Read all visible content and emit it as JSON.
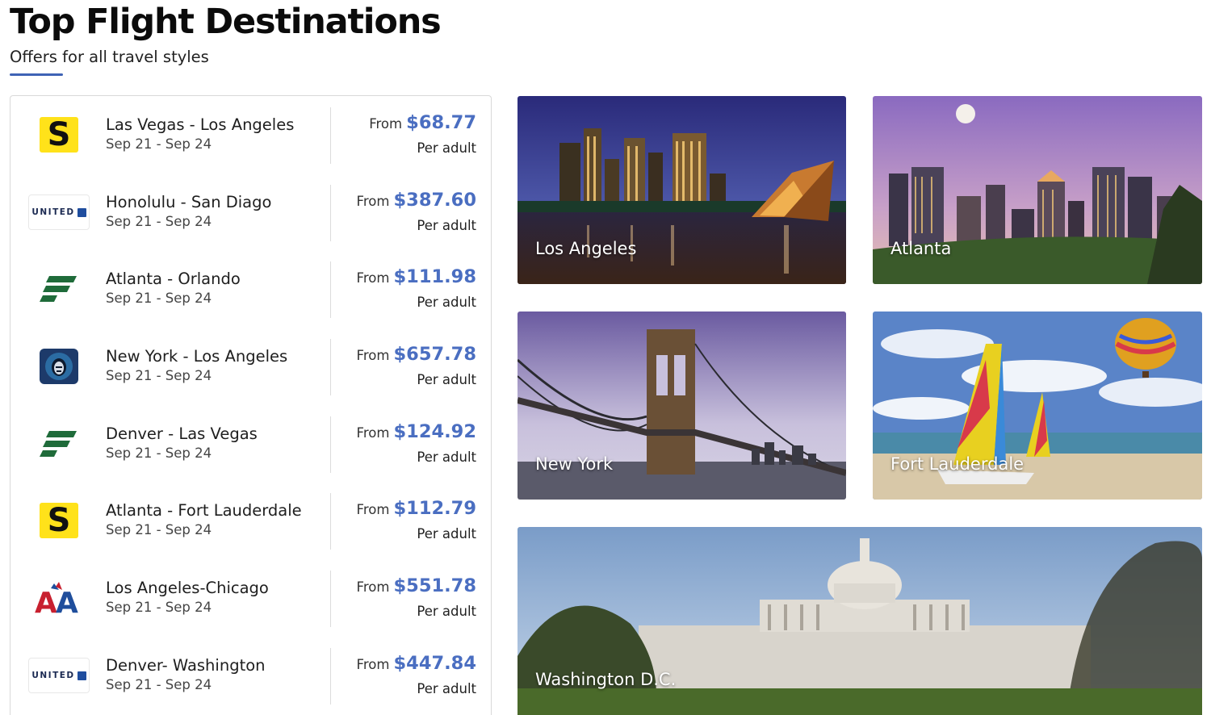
{
  "header": {
    "title": "Top Flight Destinations",
    "subtitle": "Offers for all travel styles"
  },
  "colors": {
    "accent": "#4a6ec1",
    "underline": "#3f63b5",
    "spirit_yellow": "#ffe21a",
    "frontier_green": "#1f6b3a"
  },
  "offers": [
    {
      "logo": "spirit-logo",
      "route": "Las Vegas - Los Angeles",
      "dates": "Sep 21 - Sep 24",
      "from": "From",
      "price": "$68.77",
      "per": "Per adult"
    },
    {
      "logo": "united-logo",
      "route": "Honolulu - San Diago",
      "dates": "Sep 21 - Sep 24",
      "from": "From",
      "price": "$387.60",
      "per": "Per adult"
    },
    {
      "logo": "frontier-logo",
      "route": "Atlanta - Orlando",
      "dates": "Sep 21 - Sep 24",
      "from": "From",
      "price": "$111.98",
      "per": "Per adult"
    },
    {
      "logo": "alaska-logo",
      "route": "New York - Los Angeles",
      "dates": "Sep 21 - Sep 24",
      "from": "From",
      "price": "$657.78",
      "per": "Per adult"
    },
    {
      "logo": "frontier-logo",
      "route": "Denver - Las Vegas",
      "dates": "Sep 21 - Sep 24",
      "from": "From",
      "price": "$124.92",
      "per": "Per adult"
    },
    {
      "logo": "spirit-logo",
      "route": "Atlanta - Fort Lauderdale",
      "dates": "Sep 21 - Sep 24",
      "from": "From",
      "price": "$112.79",
      "per": "Per adult"
    },
    {
      "logo": "american-logo",
      "route": "Los Angeles-Chicago",
      "dates": "Sep 21 - Sep 24",
      "from": "From",
      "price": "$551.78",
      "per": "Per adult"
    },
    {
      "logo": "united-logo",
      "route": "Denver- Washington",
      "dates": "Sep 21 - Sep 24",
      "from": "From",
      "price": "$447.84",
      "per": "Per adult"
    }
  ],
  "logo_text": {
    "spirit": "S",
    "united": "UNITED",
    "american": "AA"
  },
  "destinations": [
    {
      "name": "Los Angeles"
    },
    {
      "name": "Atlanta"
    },
    {
      "name": "New York"
    },
    {
      "name": "Fort Lauderdale"
    },
    {
      "name": "Washington D.C."
    }
  ]
}
